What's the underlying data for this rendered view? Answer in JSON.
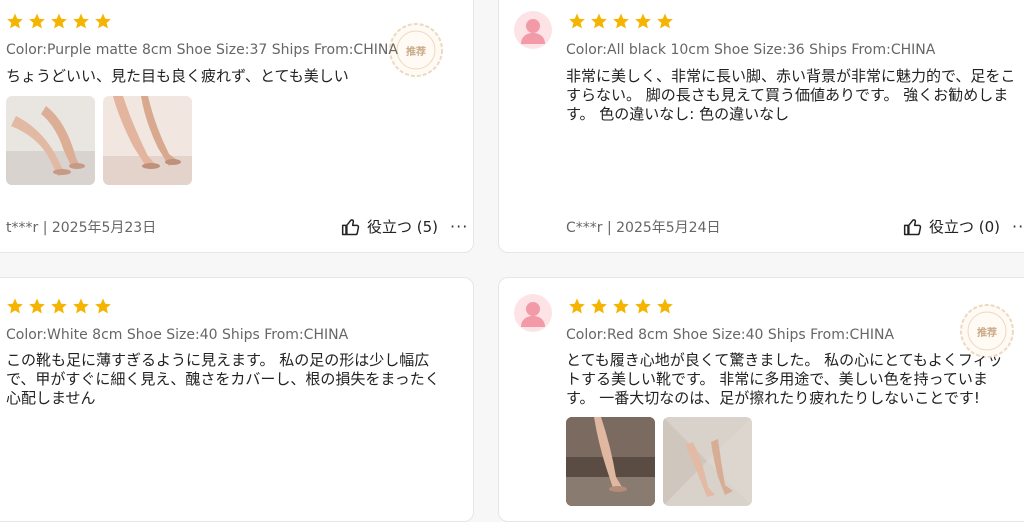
{
  "colors": {
    "star": "#f5b400",
    "avatar_bg": "#fde3e6",
    "avatar_fg": "#f29aa7",
    "badge": "#d9b892"
  },
  "icons": {
    "rating": "star-icon",
    "helpful": "thumbs-up-icon",
    "more": "more-horizontal-icon",
    "user": "user-avatar-icon",
    "badge": "recommended-seal-icon"
  },
  "reviews": [
    {
      "rating": 5,
      "meta": "Color:Purple matte 8cm Shoe Size:37 Ships From:CHINA",
      "text": "ちょうどいい、見た目も良く疲れず、とても美しい",
      "author_date": "t***r | 2025年5月23日",
      "helpful_label": "役立つ (5)",
      "more": "···",
      "badge": "推荐",
      "photos": 2
    },
    {
      "rating": 5,
      "meta": "Color:All black 10cm Shoe Size:36 Ships From:CHINA",
      "text": "非常に美しく、非常に長い脚、赤い背景が非常に魅力的で、足をこすらない。 脚の長さも見えて買う価値ありです。 強くお勧めします。 色の違いなし: 色の違いなし",
      "author_date": "C***r | 2025年5月24日",
      "helpful_label": "役立つ (0)",
      "more": "···",
      "photos": 0
    },
    {
      "rating": 5,
      "meta": "Color:White 8cm Shoe Size:40 Ships From:CHINA",
      "text": "この靴も足に薄すぎるように見えます。 私の足の形は少し幅広で、甲がすぐに細く見え、醜さをカバーし、根の損失をまったく心配しません",
      "photos": 0
    },
    {
      "rating": 5,
      "meta": "Color:Red 8cm Shoe Size:40 Ships From:CHINA",
      "text": "とても履き心地が良くて驚きました。 私の心にとてもよくフィットする美しい靴です。 非常に多用途で、美しい色を持っています。 一番大切なのは、足が擦れたり疲れたりしないことです!",
      "badge": "推荐",
      "photos": 2
    }
  ]
}
